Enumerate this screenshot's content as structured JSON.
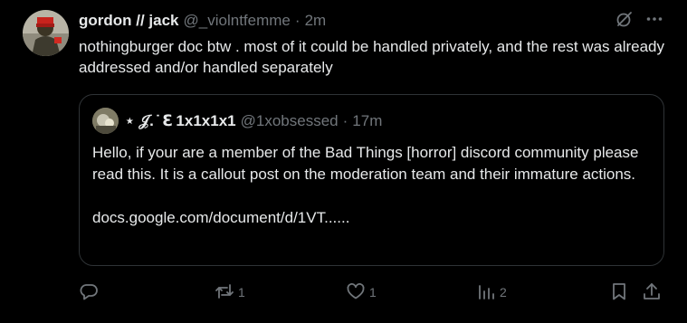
{
  "tweet": {
    "author_name": "gordon // jack",
    "author_handle": "@_violntfemme",
    "separator": "·",
    "time": "2m",
    "text": "nothingburger doc btw . most of it could be handled privately, and the rest was already addressed and/or handled separately"
  },
  "quoted": {
    "author_name": "⋆ 𝒥. ̇ ℇ 1x1x1x1",
    "author_handle": "@1xobsessed",
    "separator": "·",
    "time": "17m",
    "text": "Hello, if your are a member of the Bad Things [horror] discord community please read this. It is a callout post on the moderation team and their immature actions.\n\ndocs.google.com/document/d/1VT......"
  },
  "actions": {
    "reply_count": "",
    "retweet_count": "1",
    "like_count": "1",
    "views_count": "2"
  },
  "icons": {
    "top": [
      "grok-icon",
      "more-icon"
    ],
    "bottom": [
      "reply-icon",
      "retweet-icon",
      "like-icon",
      "views-icon",
      "bookmark-icon",
      "share-icon"
    ]
  },
  "colors": {
    "background": "#000000",
    "text": "#e7e9ea",
    "muted": "#71767b",
    "border": "#2f3336"
  }
}
